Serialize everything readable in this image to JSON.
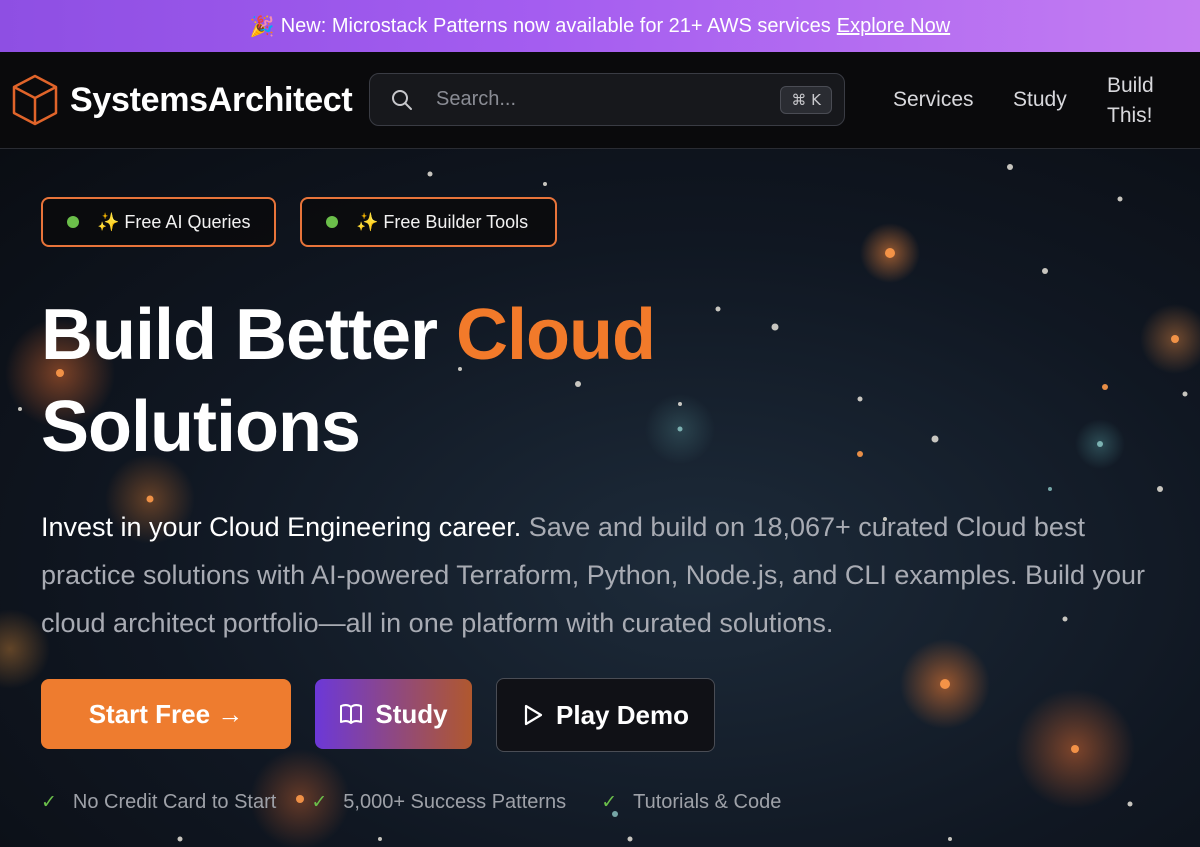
{
  "announcement": {
    "emoji": "🎉",
    "text": "New: Microstack Patterns now available for 21+ AWS services",
    "link": "Explore Now"
  },
  "nav": {
    "brand": "SystemsArchitect",
    "search_placeholder": "Search...",
    "shortcut": "⌘ K",
    "links": [
      "Services",
      "Study",
      "Build This!"
    ]
  },
  "hero": {
    "badges": [
      "✨ Free AI Queries",
      "✨ Free Builder Tools"
    ],
    "headline_part1": "Build Better ",
    "headline_accent": "Cloud",
    "headline_part2": "Solutions",
    "sub_lead": "Invest in your Cloud Engineering career.",
    "sub_rest": " Save and build on 18,067+ curated Cloud best practice solutions with AI-powered Terraform, Python, Node.js, and CLI examples. Build your cloud architect portfolio—all in one platform with curated solutions.",
    "buttons": {
      "start": "Start Free →",
      "study": "Study",
      "demo": "Play Demo"
    },
    "checks": [
      "No Credit Card to Start",
      "5,000+ Success Patterns",
      "Tutorials & Code"
    ]
  },
  "colors": {
    "accent": "#f27a2a",
    "announce_start": "#8e4fe3",
    "announce_end": "#c47df2",
    "success": "#6bbf4a"
  },
  "icons": [
    "cube-logo-icon",
    "search-icon",
    "book-icon",
    "play-icon",
    "check-icon",
    "party-icon",
    "sparkles-icon"
  ]
}
